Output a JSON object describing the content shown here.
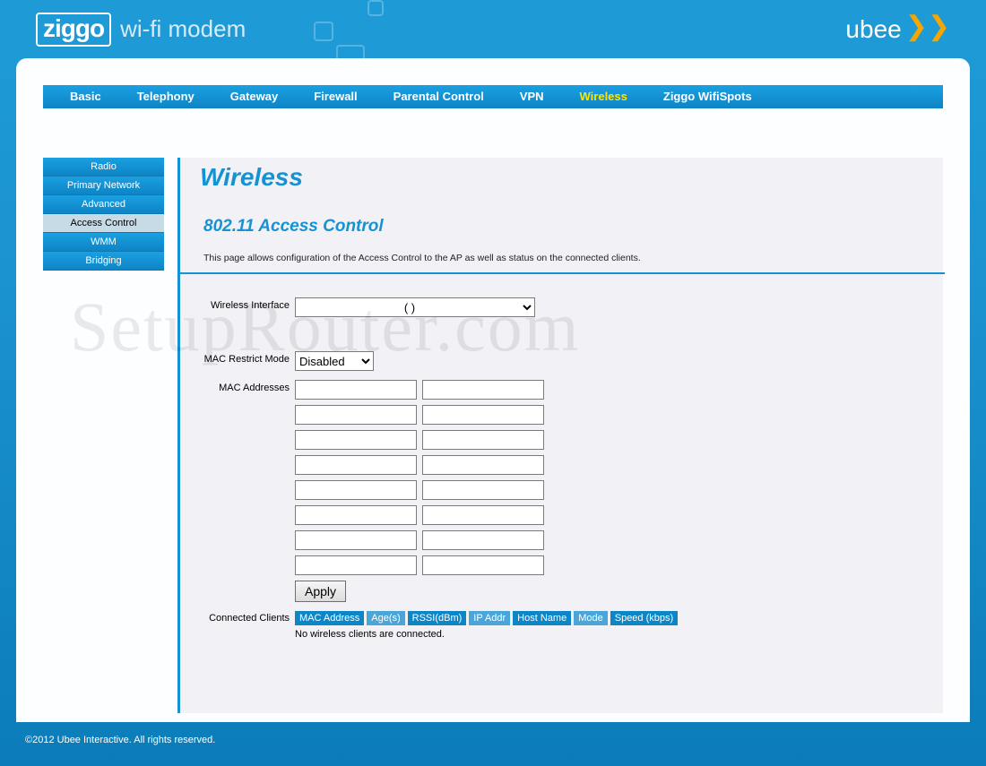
{
  "brand": {
    "ziggo": "ziggo",
    "subtitle": "wi-fi modem",
    "ubee": "ubee"
  },
  "topnav": {
    "items": [
      "Basic",
      "Telephony",
      "Gateway",
      "Firewall",
      "Parental Control",
      "VPN",
      "Wireless",
      "Ziggo WifiSpots"
    ],
    "active_index": 6
  },
  "sidebar": {
    "items": [
      "Radio",
      "Primary Network",
      "Advanced",
      "Access Control",
      "WMM",
      "Bridging"
    ],
    "selected_index": 3
  },
  "page": {
    "title": "Wireless",
    "subtitle": "802.11 Access Control",
    "description": "This page allows configuration of the Access Control to the AP as well as status on the connected clients."
  },
  "form": {
    "wireless_interface": {
      "label": "Wireless Interface",
      "selected": "(                              )"
    },
    "mac_restrict_mode": {
      "label": "MAC Restrict Mode",
      "selected": "Disabled"
    },
    "mac_addresses": {
      "label": "MAC Addresses",
      "rows": 8,
      "cols": 2
    },
    "apply_label": "Apply"
  },
  "connected_clients": {
    "label": "Connected Clients",
    "headers": [
      "MAC Address",
      "Age(s)",
      "RSSI(dBm)",
      "IP Addr",
      "Host Name",
      "Mode",
      "Speed (kbps)"
    ],
    "empty_text": "No wireless clients are connected."
  },
  "footer": "©2012 Ubee Interactive. All rights reserved.",
  "watermark": "SetupRouter.com"
}
